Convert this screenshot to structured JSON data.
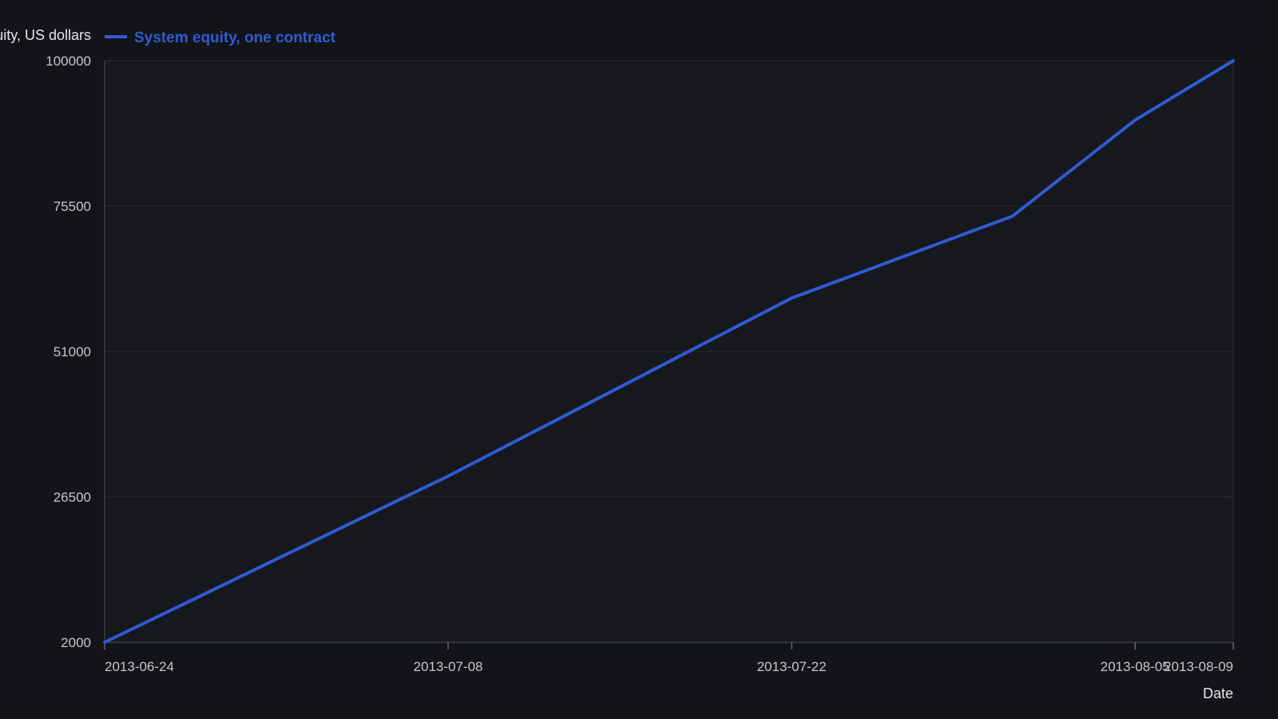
{
  "chart_data": {
    "type": "line",
    "xlabel": "Date",
    "ylabel": "Equity, US dollars",
    "x_tick_labels": [
      "2013-06-24",
      "2013-07-08",
      "2013-07-22",
      "2013-08-05",
      "2013-08-09"
    ],
    "y_tick_labels": [
      "2000",
      "26500",
      "51000",
      "75500",
      "100000"
    ],
    "ylim": [
      2000,
      100000
    ],
    "xlim": [
      "2013-06-24",
      "2013-08-09"
    ],
    "grid": "horizontal",
    "legend": "top-left",
    "series": [
      {
        "name": "System equity, one contract",
        "color": "#2F5BD3",
        "x": [
          "2013-06-24",
          "2013-07-08",
          "2013-07-22",
          "2013-07-31",
          "2013-08-05",
          "2013-08-09"
        ],
        "y": [
          2000,
          30000,
          60000,
          73800,
          90000,
          100000
        ]
      }
    ]
  }
}
